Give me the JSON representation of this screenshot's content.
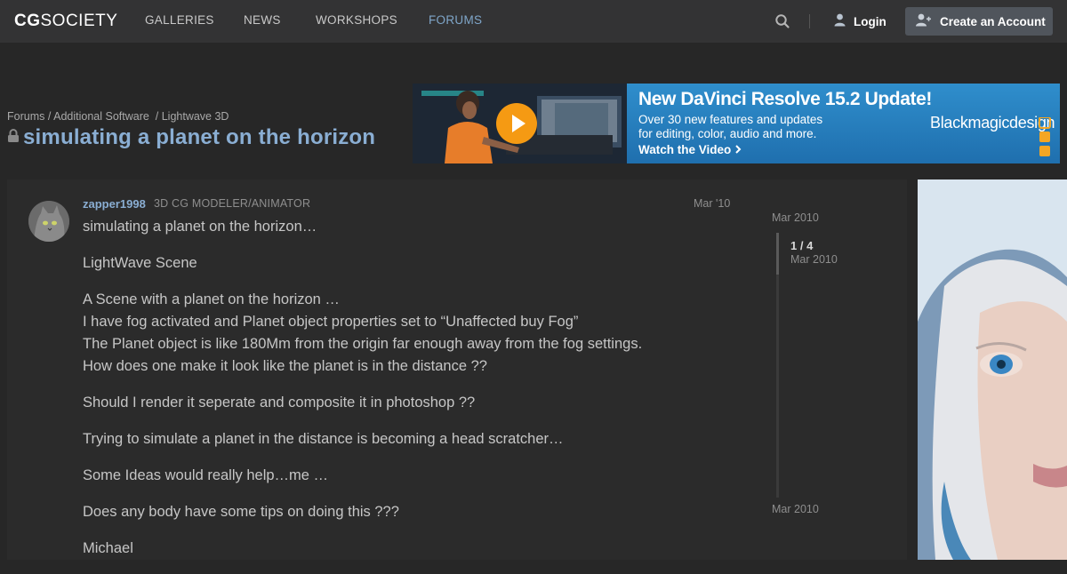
{
  "header": {
    "logo_cg": "CG",
    "logo_society": "SOCIETY",
    "nav": [
      {
        "label": "GALLERIES"
      },
      {
        "label": "NEWS"
      },
      {
        "label": "WORKSHOPS"
      },
      {
        "label": "FORUMS",
        "active": true
      }
    ],
    "login_label": "Login",
    "create_account_label": "Create an Account"
  },
  "breadcrumb": {
    "items": [
      "Forums",
      "Additional Software",
      "Lightwave 3D"
    ]
  },
  "topic": {
    "title": "simulating a planet on the horizon"
  },
  "ad_banner": {
    "headline": "New DaVinci Resolve 15.2 Update!",
    "sub_line1": "Over 30 new features and updates",
    "sub_line2": "for editing, color, audio and more.",
    "cta": "Watch the Video",
    "brand": "Blackmagicdesign"
  },
  "post": {
    "username": "zapper1998",
    "user_title": "3D CG MODELER/ANIMATOR",
    "date": "Mar '10",
    "body": [
      [
        "simulating a planet on the horizon…"
      ],
      [
        "LightWave Scene"
      ],
      [
        "A Scene with a planet on the horizon …",
        "I have fog activated and Planet object properties set to “Unaffected buy Fog”",
        "The Planet object is like 180Mm from the origin far enough away from the fog settings.",
        "How does one make it look like the planet is in the distance ??"
      ],
      [
        "Should I render it seperate and composite it in photoshop ??"
      ],
      [
        "Trying to simulate a planet in the distance is becoming a head scratcher…"
      ],
      [
        "Some Ideas would really help…me …"
      ],
      [
        "Does any body have some tips on doing this ???"
      ],
      [
        "Michael"
      ]
    ]
  },
  "timeline": {
    "top_date": "Mar 2010",
    "count": "1 / 4",
    "current_date": "Mar 2010",
    "bottom_date": "Mar 2010",
    "progress": 0.25
  },
  "colors": {
    "accent": "#8aaed3",
    "header_bg": "#333334",
    "page_bg": "#272727",
    "ad_blue": "#2a7ab7",
    "play_orange": "#f59a13"
  }
}
